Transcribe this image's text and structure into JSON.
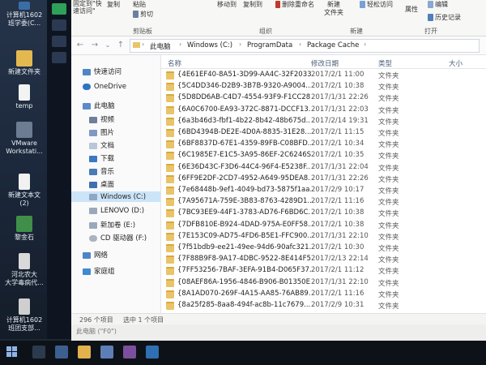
{
  "desktop": {
    "icons": [
      {
        "label": "计算机1602\n班学委(C..."
      },
      {
        "label": ""
      },
      {
        "label": "新建文件夹"
      },
      {
        "label": "temp"
      },
      {
        "label": "VMware\nWorkstati..."
      },
      {
        "label": "新建文本文\n(2)"
      },
      {
        "label": "黎金石"
      },
      {
        "label": "河北农大\n大学毒病代..."
      },
      {
        "label": "计算机1602\n班团支部..."
      }
    ]
  },
  "ribbon": {
    "items": {
      "fixed": "固定到\"快\n速访问\"",
      "copy": "复制",
      "paste": "粘贴",
      "cut": "剪切",
      "move_to": "移动到",
      "copy_to": "复制到",
      "delete": "删除",
      "rename": "重命名",
      "new_folder": "新建\n文件夹",
      "easy_access": "轻松访问",
      "edit": "编辑",
      "properties": "属性",
      "history": "历史记录"
    },
    "groups": {
      "clipboard": "剪贴板",
      "organize": "组织",
      "new": "新建",
      "open": "打开"
    }
  },
  "address": {
    "crumbs": [
      "此电脑",
      "Windows (C:)",
      "ProgramData",
      "Package Cache"
    ]
  },
  "navpane": {
    "items": [
      "快速访问",
      "OneDrive",
      "此电脑",
      "视频",
      "图片",
      "文档",
      "下载",
      "音乐",
      "桌面",
      "Windows (C:)",
      "LENOVO (D:)",
      "新加卷 (E:)",
      "CD 驱动器 (F:)",
      "网络",
      "家庭组"
    ]
  },
  "columns": {
    "name": "名称",
    "date": "修改日期",
    "type": "类型",
    "size": "大小"
  },
  "files": [
    {
      "name": "{4E61EF40-8A51-3D99-AA4C-32F2033...",
      "date": "2017/2/1 11:00",
      "type": "文件夹"
    },
    {
      "name": "{5C4DD346-D2B9-3B7B-9320-A9004...",
      "date": "2017/2/1 10:38",
      "type": "文件夹"
    },
    {
      "name": "{5D8DD6AB-C4D7-4554-93F9-F1CC28...",
      "date": "2017/1/31 22:26",
      "type": "文件夹"
    },
    {
      "name": "{6A0C6700-EA93-372C-8871-DCCF13...",
      "date": "2017/1/31 22:03",
      "type": "文件夹"
    },
    {
      "name": "{6a3b46d3-fbf1-4b22-8b42-48b675d...",
      "date": "2017/2/14 19:31",
      "type": "文件夹"
    },
    {
      "name": "{6BD4394B-DE2E-4D0A-8835-31E28...",
      "date": "2017/2/1 11:15",
      "type": "文件夹"
    },
    {
      "name": "{6BF8837D-67E1-4359-89FB-C08BFD...",
      "date": "2017/2/1 10:34",
      "type": "文件夹"
    },
    {
      "name": "{6C1985E7-E1C5-3A95-86EF-2C6246S...",
      "date": "2017/2/1 10:35",
      "type": "文件夹"
    },
    {
      "name": "{6E36D43C-F3D6-44C4-96F4-E5238F...",
      "date": "2017/1/31 22:04",
      "type": "文件夹"
    },
    {
      "name": "{6FF9E2DF-2CD7-4952-A649-95DEA8...",
      "date": "2017/1/31 22:26",
      "type": "文件夹"
    },
    {
      "name": "{7e68448b-9ef1-4049-bd73-5875f1aa...",
      "date": "2017/2/9 10:17",
      "type": "文件夹"
    },
    {
      "name": "{7A95671A-759E-3B83-8763-4289D1...",
      "date": "2017/2/1 11:16",
      "type": "文件夹"
    },
    {
      "name": "{7BC93EE9-44F1-3783-AD76-F6BD6C...",
      "date": "2017/2/1 10:38",
      "type": "文件夹"
    },
    {
      "name": "{7DFB810E-B924-4DAD-975A-E0FF58...",
      "date": "2017/2/1 10:38",
      "type": "文件夹"
    },
    {
      "name": "{7E153C09-AD75-4FD6-B5E1-FFC900...",
      "date": "2017/1/31 22:10",
      "type": "文件夹"
    },
    {
      "name": "{7f51bdb9-ee21-49ee-94d6-90afc321...",
      "date": "2017/2/1 10:30",
      "type": "文件夹"
    },
    {
      "name": "{7F88B9F8-9A17-4DBC-9522-8E414F5...",
      "date": "2017/2/13 22:14",
      "type": "文件夹"
    },
    {
      "name": "{7FF53256-7BAF-3EFA-91B4-D065F37...",
      "date": "2017/2/1 11:12",
      "type": "文件夹"
    },
    {
      "name": "{08AEF86A-1956-4846-B906-B01350E...",
      "date": "2017/1/31 22:10",
      "type": "文件夹"
    },
    {
      "name": "{8A1AD070-269F-4A15-AA85-76AB89...",
      "date": "2017/2/1 11:16",
      "type": "文件夹"
    },
    {
      "name": "{8a25f285-8aa8-494f-ac8b-11c7679...",
      "date": "2017/2/9 10:31",
      "type": "文件夹"
    }
  ],
  "status": {
    "count": "296 个项目",
    "selected": "选中 1 个项目"
  },
  "bottom": {
    "label": "此电脑 (\"F0\")"
  },
  "colors": {
    "folder": "#e9c46a",
    "selection": "#cce4f7",
    "header_text": "#4c607a"
  }
}
